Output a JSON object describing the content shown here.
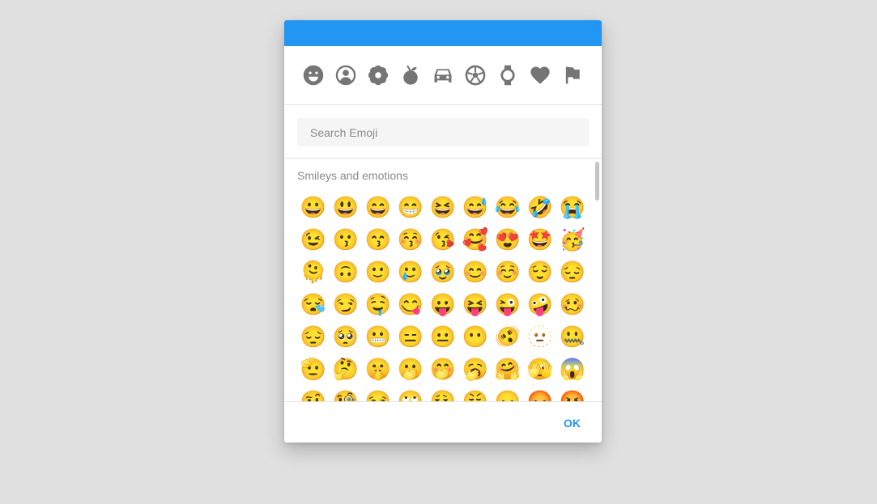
{
  "colors": {
    "accent": "#2196f3",
    "icon_gray": "#757575",
    "background": "#e0e0e0"
  },
  "categories": [
    {
      "icon": "smiley-icon"
    },
    {
      "icon": "person-icon"
    },
    {
      "icon": "flower-icon"
    },
    {
      "icon": "fruit-icon"
    },
    {
      "icon": "car-icon"
    },
    {
      "icon": "soccer-ball-icon"
    },
    {
      "icon": "watch-icon"
    },
    {
      "icon": "heart-icon"
    },
    {
      "icon": "flag-icon"
    }
  ],
  "search": {
    "placeholder": "Search Emoji",
    "value": ""
  },
  "section": {
    "title": "Smileys and emotions"
  },
  "emojis": [
    "😀",
    "😃",
    "😄",
    "😁",
    "😆",
    "😅",
    "😂",
    "🤣",
    "😭",
    "😉",
    "😗",
    "😙",
    "😚",
    "😘",
    "🥰",
    "😍",
    "🤩",
    "🥳",
    "🫠",
    "🙃",
    "🙂",
    "🥲",
    "🥹",
    "😊",
    "☺️",
    "😌",
    "😔",
    "😪",
    "😏",
    "🤤",
    "😋",
    "😛",
    "😝",
    "😜",
    "🤪",
    "🥴",
    "😔",
    "🥺",
    "😬",
    "😑",
    "😐",
    "😶",
    "🫨",
    "🫥",
    "🤐",
    "🫡",
    "🤔",
    "🤫",
    "🫢",
    "🤭",
    "🥱",
    "🤗",
    "🫣",
    "😱",
    "🤨",
    "🧐",
    "😒",
    "🙄",
    "😮‍💨",
    "😤",
    "😠",
    "😡",
    "🤬"
  ],
  "footer": {
    "ok_label": "OK"
  }
}
